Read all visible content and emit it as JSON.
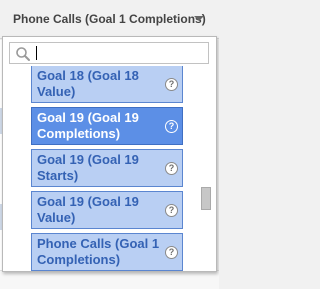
{
  "header": {
    "selected_metric": "Phone Calls (Goal 1 Completions)",
    "dropdown_icon": "triangle-down-icon"
  },
  "search": {
    "value": "",
    "placeholder": "",
    "icon": "search-icon"
  },
  "items": [
    {
      "label": "Goal 18 (Goal 18 Value)",
      "selected": false,
      "help_icon": "?"
    },
    {
      "label": "Goal 19 (Goal 19 Completions)",
      "selected": true,
      "help_icon": "?"
    },
    {
      "label": "Goal 19 (Goal 19 Starts)",
      "selected": false,
      "help_icon": "?"
    },
    {
      "label": "Goal 19 (Goal 19 Value)",
      "selected": false,
      "help_icon": "?"
    },
    {
      "label": "Phone Calls (Goal 1 Completions)",
      "selected": false,
      "help_icon": "?"
    }
  ],
  "colors": {
    "item_bg": "#b9cff3",
    "item_border": "#5b86d0",
    "item_text": "#3462b4",
    "selected_bg": "#5c8fe6",
    "selected_text": "#ffffff"
  },
  "scroll": {
    "position_fraction": 0.6
  }
}
